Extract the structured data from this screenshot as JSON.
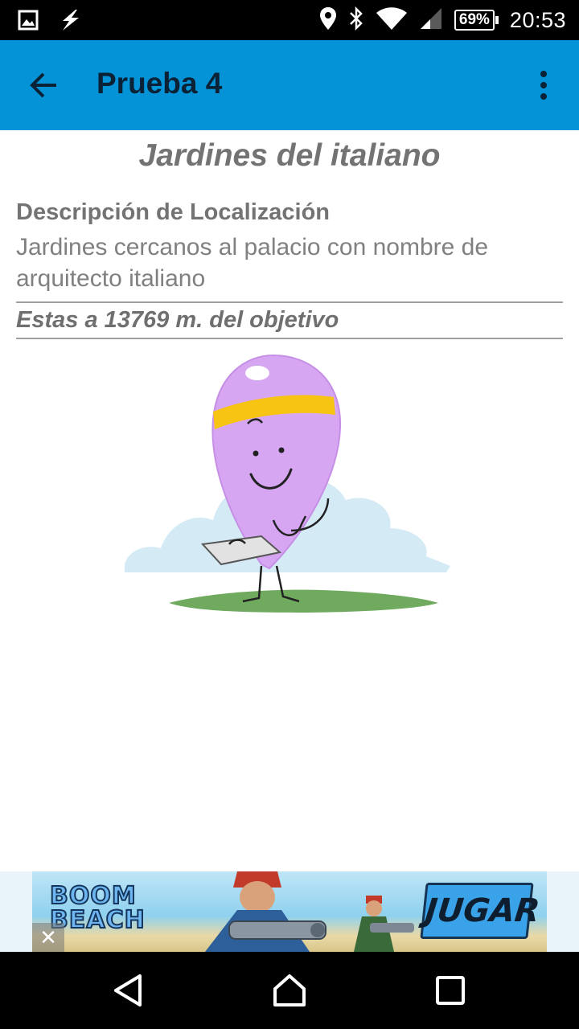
{
  "status_bar": {
    "left_icons": [
      "image-icon",
      "flash-icon"
    ],
    "right_icons": [
      "location-icon",
      "bluetooth-icon",
      "wifi-icon",
      "signal-icon"
    ],
    "battery": "69%",
    "time": "20:53"
  },
  "app_bar": {
    "back_icon": "arrow-back-icon",
    "title": "Prueba 4",
    "menu_icon": "more-vert-icon",
    "background_color": "#0393d6"
  },
  "content": {
    "place_title": "Jardines del italiano",
    "description_heading": "Descripción de Localización",
    "description_text": "Jardines cercanos al palacio con nombre de arquitecto italiano",
    "distance_text": "Estas a 13769 m. del objetivo"
  },
  "ad": {
    "logo_text": "BOOM BEACH",
    "cta_label": "JUGAR",
    "close_label": "✕"
  },
  "nav_bar": {
    "icons": [
      "back-triangle-icon",
      "home-icon",
      "recents-icon"
    ]
  }
}
